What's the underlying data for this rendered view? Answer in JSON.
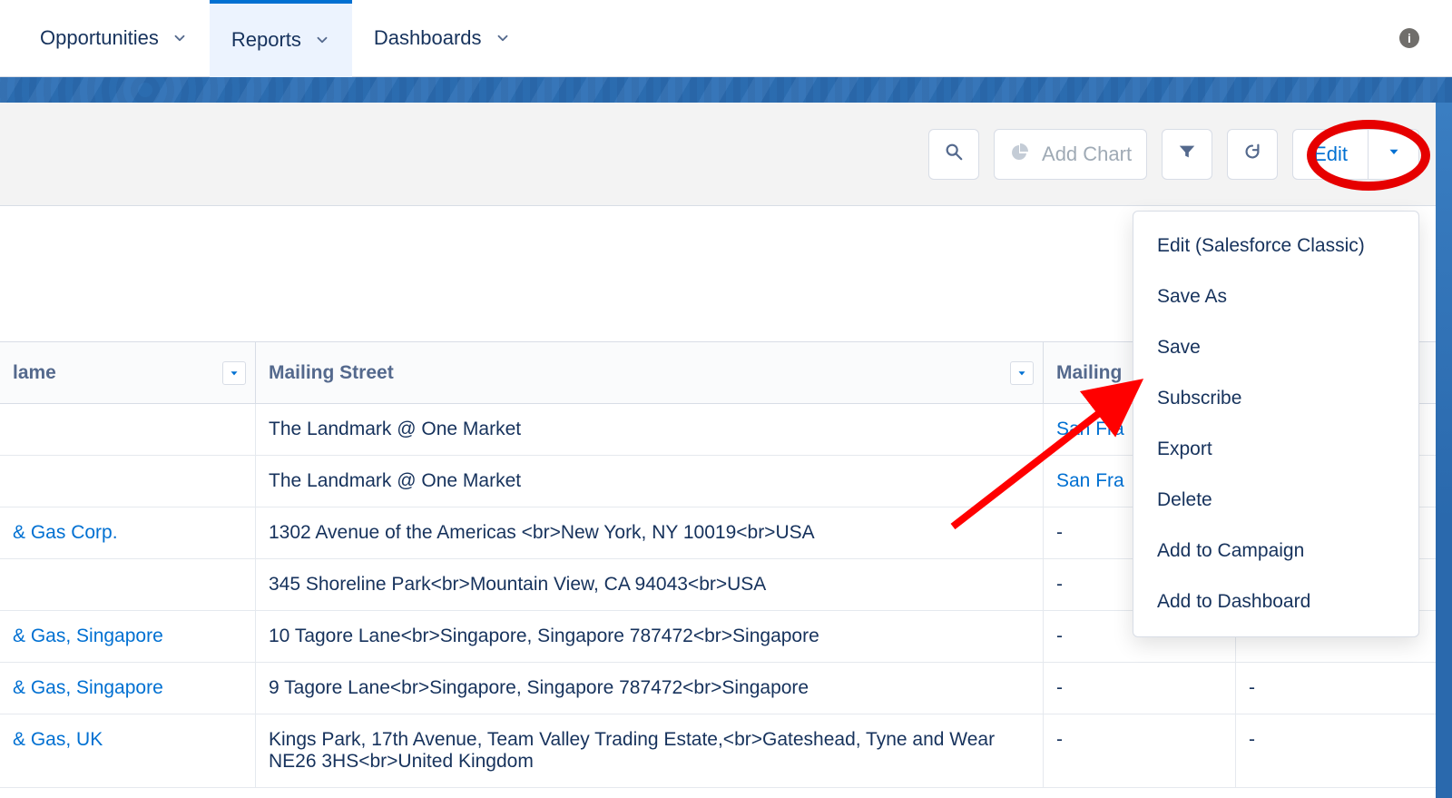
{
  "nav": {
    "items": [
      {
        "label": "Opportunities",
        "active": false
      },
      {
        "label": "Reports",
        "active": true
      },
      {
        "label": "Dashboards",
        "active": false
      }
    ]
  },
  "actions": {
    "add_chart": "Add Chart",
    "edit": "Edit"
  },
  "columns": {
    "name": "lame",
    "street": "Mailing Street",
    "city": "Mailing",
    "extra": ""
  },
  "rows": [
    {
      "name": "",
      "name_link": false,
      "street": "The Landmark @ One Market",
      "city": "San Fra",
      "city_link": true,
      "extra": ""
    },
    {
      "name": "",
      "name_link": false,
      "street": "The Landmark @ One Market",
      "city": "San Fra",
      "city_link": true,
      "extra": ""
    },
    {
      "name": "& Gas Corp.",
      "name_link": true,
      "street": "1302 Avenue of the Americas <br>New York, NY 10019<br>USA",
      "city": "-",
      "city_link": false,
      "extra": "-"
    },
    {
      "name": "",
      "name_link": false,
      "street": "345 Shoreline Park<br>Mountain View, CA 94043<br>USA",
      "city": "-",
      "city_link": false,
      "extra": "-"
    },
    {
      "name": "& Gas, Singapore",
      "name_link": true,
      "street": "10 Tagore Lane<br>Singapore, Singapore 787472<br>Singapore",
      "city": "-",
      "city_link": false,
      "extra": "-"
    },
    {
      "name": "& Gas, Singapore",
      "name_link": true,
      "street": "9 Tagore Lane<br>Singapore, Singapore 787472<br>Singapore",
      "city": "-",
      "city_link": false,
      "extra": "-"
    },
    {
      "name": "& Gas, UK",
      "name_link": true,
      "street": "Kings Park, 17th Avenue, Team Valley Trading Estate,<br>Gateshead, Tyne and Wear NE26 3HS<br>United Kingdom",
      "city": "-",
      "city_link": false,
      "extra": "-"
    }
  ],
  "menu": [
    "Edit (Salesforce Classic)",
    "Save As",
    "Save",
    "Subscribe",
    "Export",
    "Delete",
    "Add to Campaign",
    "Add to Dashboard"
  ]
}
